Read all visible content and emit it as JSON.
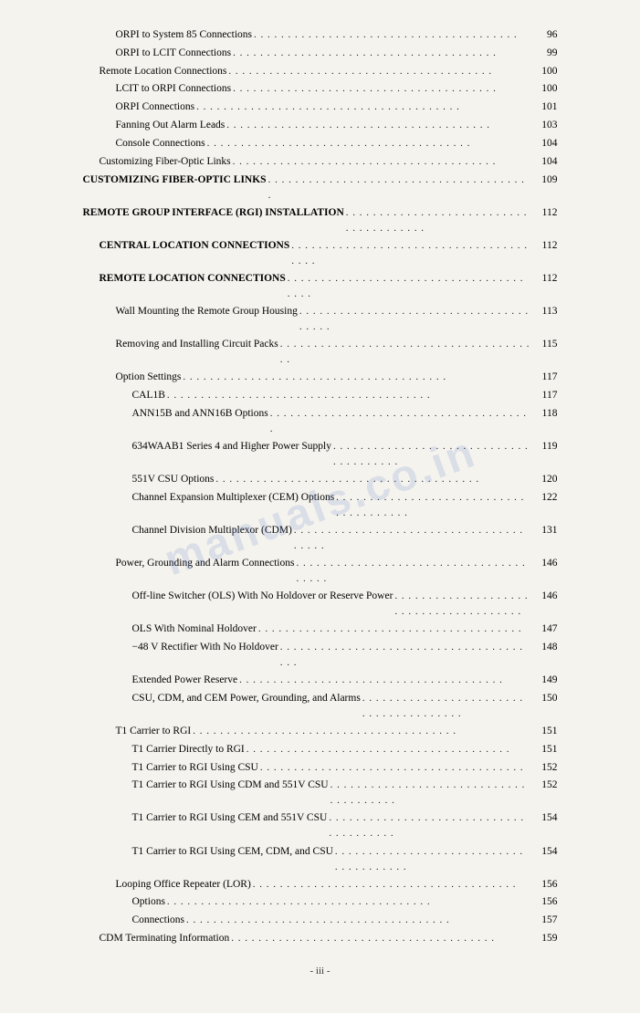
{
  "page": {
    "footer": "- iii -",
    "watermark": "manuals.co.in"
  },
  "entries": [
    {
      "id": 1,
      "indent": 2,
      "bold": false,
      "text": "ORPI to System 85 Connections",
      "page": "96"
    },
    {
      "id": 2,
      "indent": 2,
      "bold": false,
      "text": "ORPI to LCIT Connections",
      "page": "99"
    },
    {
      "id": 1,
      "indent": 1,
      "bold": false,
      "text": "Remote Location Connections",
      "page": "100"
    },
    {
      "id": 3,
      "indent": 2,
      "bold": false,
      "text": "LCIT to ORPI Connections",
      "page": "100"
    },
    {
      "id": 4,
      "indent": 2,
      "bold": false,
      "text": "ORPI Connections",
      "page": "101"
    },
    {
      "id": 5,
      "indent": 2,
      "bold": false,
      "text": "Fanning Out Alarm Leads",
      "page": "103"
    },
    {
      "id": 6,
      "indent": 2,
      "bold": false,
      "text": "Console Connections",
      "page": "104"
    },
    {
      "id": 7,
      "indent": 1,
      "bold": false,
      "text": "Customizing Fiber-Optic Links",
      "page": "104"
    },
    {
      "id": 8,
      "indent": 0,
      "bold": true,
      "text": "CUSTOMIZING FIBER-OPTIC LINKS",
      "page": "109"
    },
    {
      "id": 9,
      "indent": 0,
      "bold": true,
      "text": "REMOTE GROUP INTERFACE (RGI) INSTALLATION",
      "page": "112"
    },
    {
      "id": 10,
      "indent": 1,
      "bold": true,
      "text": "CENTRAL LOCATION CONNECTIONS",
      "page": "112"
    },
    {
      "id": 11,
      "indent": 1,
      "bold": true,
      "text": "REMOTE LOCATION CONNECTIONS",
      "page": "112"
    },
    {
      "id": 12,
      "indent": 2,
      "bold": false,
      "text": "Wall Mounting the Remote Group Housing",
      "page": "113"
    },
    {
      "id": 13,
      "indent": 2,
      "bold": false,
      "text": "Removing and Installing Circuit Packs",
      "page": "115"
    },
    {
      "id": 14,
      "indent": 2,
      "bold": false,
      "text": "Option Settings",
      "page": "117"
    },
    {
      "id": 15,
      "indent": 3,
      "bold": false,
      "text": "CAL1B",
      "page": "117"
    },
    {
      "id": 16,
      "indent": 3,
      "bold": false,
      "text": "ANN15B and ANN16B Options",
      "page": "118"
    },
    {
      "id": 17,
      "indent": 3,
      "bold": false,
      "text": "634WAAB1 Series 4 and Higher Power Supply",
      "page": "119"
    },
    {
      "id": 18,
      "indent": 3,
      "bold": false,
      "text": "551V CSU Options",
      "page": "120"
    },
    {
      "id": 19,
      "indent": 3,
      "bold": false,
      "text": "Channel Expansion Multiplexer (CEM) Options",
      "page": "122"
    },
    {
      "id": 20,
      "indent": 3,
      "bold": false,
      "text": "Channel Division Multiplexor (CDM)",
      "page": "131"
    },
    {
      "id": 21,
      "indent": 2,
      "bold": false,
      "text": "Power, Grounding and Alarm Connections",
      "page": "146"
    },
    {
      "id": 22,
      "indent": 3,
      "bold": false,
      "text": "Off-line Switcher (OLS) With No Holdover or Reserve Power",
      "page": "146"
    },
    {
      "id": 23,
      "indent": 3,
      "bold": false,
      "text": "OLS With Nominal Holdover",
      "page": "147"
    },
    {
      "id": 24,
      "indent": 3,
      "bold": false,
      "text": "−48 V Rectifier With No Holdover",
      "page": "148"
    },
    {
      "id": 25,
      "indent": 3,
      "bold": false,
      "text": "Extended Power Reserve",
      "page": "149"
    },
    {
      "id": 26,
      "indent": 3,
      "bold": false,
      "text": "CSU, CDM, and CEM Power, Grounding, and Alarms",
      "page": "150"
    },
    {
      "id": 27,
      "indent": 2,
      "bold": false,
      "text": "T1 Carrier to RGI",
      "page": "151"
    },
    {
      "id": 28,
      "indent": 3,
      "bold": false,
      "text": "T1 Carrier Directly to RGI",
      "page": "151"
    },
    {
      "id": 29,
      "indent": 3,
      "bold": false,
      "text": "T1 Carrier to RGI Using CSU",
      "page": "152"
    },
    {
      "id": 30,
      "indent": 3,
      "bold": false,
      "text": "T1 Carrier to RGI Using CDM and 551V CSU",
      "page": "152"
    },
    {
      "id": 31,
      "indent": 3,
      "bold": false,
      "text": "T1 Carrier to RGI Using CEM and 551V CSU",
      "page": "154"
    },
    {
      "id": 32,
      "indent": 3,
      "bold": false,
      "text": "T1 Carrier to RGI Using CEM, CDM, and CSU",
      "page": "154"
    },
    {
      "id": 33,
      "indent": 2,
      "bold": false,
      "text": "Looping Office Repeater (LOR)",
      "page": "156"
    },
    {
      "id": 34,
      "indent": 3,
      "bold": false,
      "text": "Options",
      "page": "156"
    },
    {
      "id": 35,
      "indent": 3,
      "bold": false,
      "text": "Connections",
      "page": "157"
    },
    {
      "id": 36,
      "indent": 1,
      "bold": false,
      "text": "CDM Terminating Information",
      "page": "159"
    }
  ]
}
